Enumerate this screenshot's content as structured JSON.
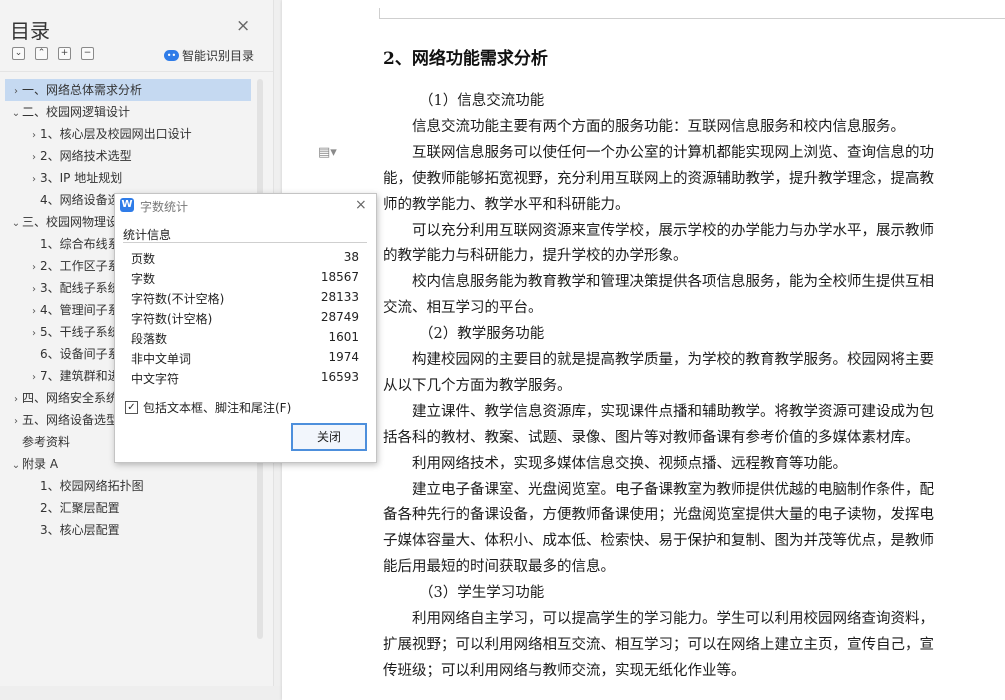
{
  "sidebar": {
    "title": "目录",
    "close_glyph": "×",
    "tools": [
      {
        "icon": "chevron-down-icon",
        "glyph": "⌄"
      },
      {
        "icon": "chevron-up-icon",
        "glyph": "⌃"
      },
      {
        "icon": "plus-icon",
        "glyph": "+"
      },
      {
        "icon": "minus-icon",
        "glyph": "−"
      }
    ],
    "smart_toc": {
      "icon": "ai-icon",
      "label": "智能识别目录"
    },
    "toc": [
      {
        "label": "一、网络总体需求分析",
        "arrow": "›",
        "indent": 0,
        "selected": true
      },
      {
        "label": "二、校园网逻辑设计",
        "arrow": "⌄",
        "indent": 0
      },
      {
        "label": "1、核心层及校园网出口设计",
        "arrow": "›",
        "indent": 1
      },
      {
        "label": "2、网络技术选型",
        "arrow": "›",
        "indent": 1
      },
      {
        "label": "3、IP 地址规划",
        "arrow": "›",
        "indent": 1
      },
      {
        "label": "4、网络设备选型",
        "arrow": "",
        "indent": 1
      },
      {
        "label": "三、校园网物理设计",
        "arrow": "⌄",
        "indent": 0
      },
      {
        "label": "1、综合布线系统",
        "arrow": "",
        "indent": 1
      },
      {
        "label": "2、工作区子系统",
        "arrow": "›",
        "indent": 1
      },
      {
        "label": "3、配线子系统",
        "arrow": "›",
        "indent": 1
      },
      {
        "label": "4、管理间子系统",
        "arrow": "›",
        "indent": 1
      },
      {
        "label": "5、干线子系统",
        "arrow": "›",
        "indent": 1
      },
      {
        "label": "6、设备间子系统",
        "arrow": "",
        "indent": 1
      },
      {
        "label": "7、建筑群和进线",
        "arrow": "›",
        "indent": 1
      },
      {
        "label": "四、网络安全系统",
        "arrow": "›",
        "indent": 0
      },
      {
        "label": "五、网络设备选型",
        "arrow": "›",
        "indent": 0
      },
      {
        "label": "参考资料",
        "arrow": "",
        "indent": 0
      },
      {
        "label": "附录 A",
        "arrow": "⌄",
        "indent": 0
      },
      {
        "label": "1、校园网络拓扑图",
        "arrow": "",
        "indent": 1
      },
      {
        "label": "2、汇聚层配置",
        "arrow": "",
        "indent": 1
      },
      {
        "label": "3、核心层配置",
        "arrow": "",
        "indent": 1
      }
    ]
  },
  "document": {
    "heading": "2、网络功能需求分析",
    "lines": [
      "（1）信息交流功能",
      "信息交流功能主要有两个方面的服务功能：互联网信息服务和校内信息服务。",
      "互联网信息服务可以使任何一个办公室的计算机都能实现网上浏览、查询信息的功",
      "能，使教师能够拓宽视野，充分利用互联网上的资源辅助教学，提升教学理念，提高教",
      "师的教学能力、教学水平和科研能力。",
      "可以充分利用互联网资源来宣传学校，展示学校的办学能力与办学水平，展示教师",
      "的教学能力与科研能力，提升学校的办学形象。",
      "校内信息服务能为教育教学和管理决策提供各项信息服务，能为全校师生提供互相",
      "交流、相互学习的平台。",
      "（2）教学服务功能",
      "构建校园网的主要目的就是提高教学质量，为学校的教育教学服务。校园网将主要",
      "从以下几个方面为教学服务。",
      "建立课件、教学信息资源库，实现课件点播和辅助教学。将教学资源可建设成为包",
      "括各科的教材、教案、试题、录像、图片等对教师备课有参考价值的多媒体素材库。",
      "利用网络技术，实现多媒体信息交换、视频点播、远程教育等功能。",
      "建立电子备课室、光盘阅览室。电子备课教室为教师提供优越的电脑制作条件，配",
      "备各种先行的备课设备，方便教师备课使用；光盘阅览室提供大量的电子读物，发挥电",
      "子媒体容量大、体积小、成本低、检索快、易于保护和复制、图为并茂等优点，是教师",
      "能后用最短的时间获取最多的信息。",
      "（3）学生学习功能",
      "利用网络自主学习，可以提高学生的学习能力。学生可以利用校园网络查询资料，",
      "扩展视野；可以利用网络相互交流、相互学习；可以在网络上建立主页，宣传自己，宣",
      "传班级；可以利用网络与教师交流，实现无纸化作业等。"
    ]
  },
  "dialog": {
    "icon_letter": "W",
    "title": "字数统计",
    "close_glyph": "×",
    "section": "统计信息",
    "stats": [
      {
        "label": "页数",
        "value": "38"
      },
      {
        "label": "字数",
        "value": "18567"
      },
      {
        "label": "字符数(不计空格)",
        "value": "28133"
      },
      {
        "label": "字符数(计空格)",
        "value": "28749"
      },
      {
        "label": "段落数",
        "value": "1601"
      },
      {
        "label": "非中文单词",
        "value": "1974"
      },
      {
        "label": "中文字符",
        "value": "16593"
      }
    ],
    "checkbox_label": "包括文本框、脚注和尾注(F)",
    "checkbox_checked": true,
    "close_button": "关闭"
  },
  "colors": {
    "accent": "#2f7ce8",
    "selection": "#c5d9f1"
  }
}
